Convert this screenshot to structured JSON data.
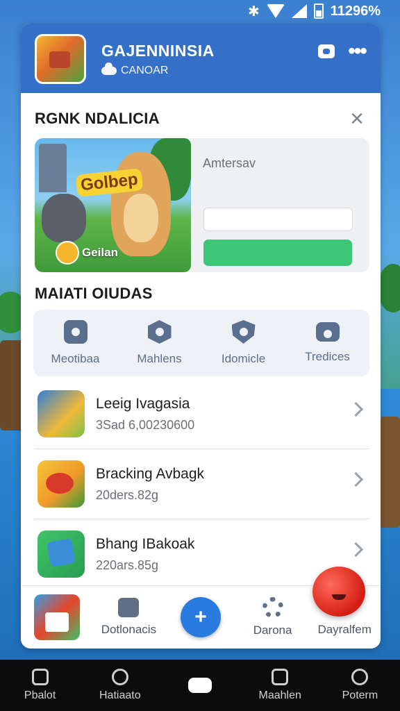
{
  "status_bar": {
    "time": "11296%"
  },
  "header": {
    "app_title": "GAJENNINSIA",
    "subtitle": "CANOAR",
    "logo": "game-logo"
  },
  "promo": {
    "heading": "RGNK NDALICIA",
    "close": "close-icon",
    "banner_text": "Golbep",
    "badge_text": "Geilan",
    "side_label": "Amtersav"
  },
  "categories": {
    "heading": "MAIATI OIUDAS",
    "items": [
      {
        "label": "Meotibaa",
        "icon": "home-icon"
      },
      {
        "label": "Mahlens",
        "icon": "hexagon-icon"
      },
      {
        "label": "Idomicle",
        "icon": "shield-icon"
      },
      {
        "label": "Tredices",
        "icon": "camera-icon"
      }
    ]
  },
  "games": [
    {
      "title": "Leeig Ivagasia",
      "subtitle": "3Sad 6,00230600"
    },
    {
      "title": "Bracking Avbagk",
      "subtitle": "20ders.82g"
    },
    {
      "title": "Bhang IBakoak",
      "subtitle": "220ars.85g"
    }
  ],
  "card_nav": [
    {
      "label": "",
      "icon": "home-icon"
    },
    {
      "label": "Dotlonacis",
      "icon": "chat-icon"
    },
    {
      "label": "",
      "icon": "plus-icon"
    },
    {
      "label": "Darona",
      "icon": "gear-icon"
    },
    {
      "label": "Dayralfem",
      "icon": "mascot-icon"
    }
  ],
  "system_nav": [
    {
      "label": "Pbalot",
      "icon": "home-icon"
    },
    {
      "label": "Hatiaato",
      "icon": "people-icon"
    },
    {
      "label": "",
      "icon": "home-pill"
    },
    {
      "label": "Maahlen",
      "icon": "message-icon"
    },
    {
      "label": "Poterm",
      "icon": "clock-icon"
    }
  ],
  "colors": {
    "header_blue": "#3470c8",
    "accent_green": "#3cc878",
    "fab_blue": "#2a7be0",
    "mascot_red": "#d41e14"
  }
}
